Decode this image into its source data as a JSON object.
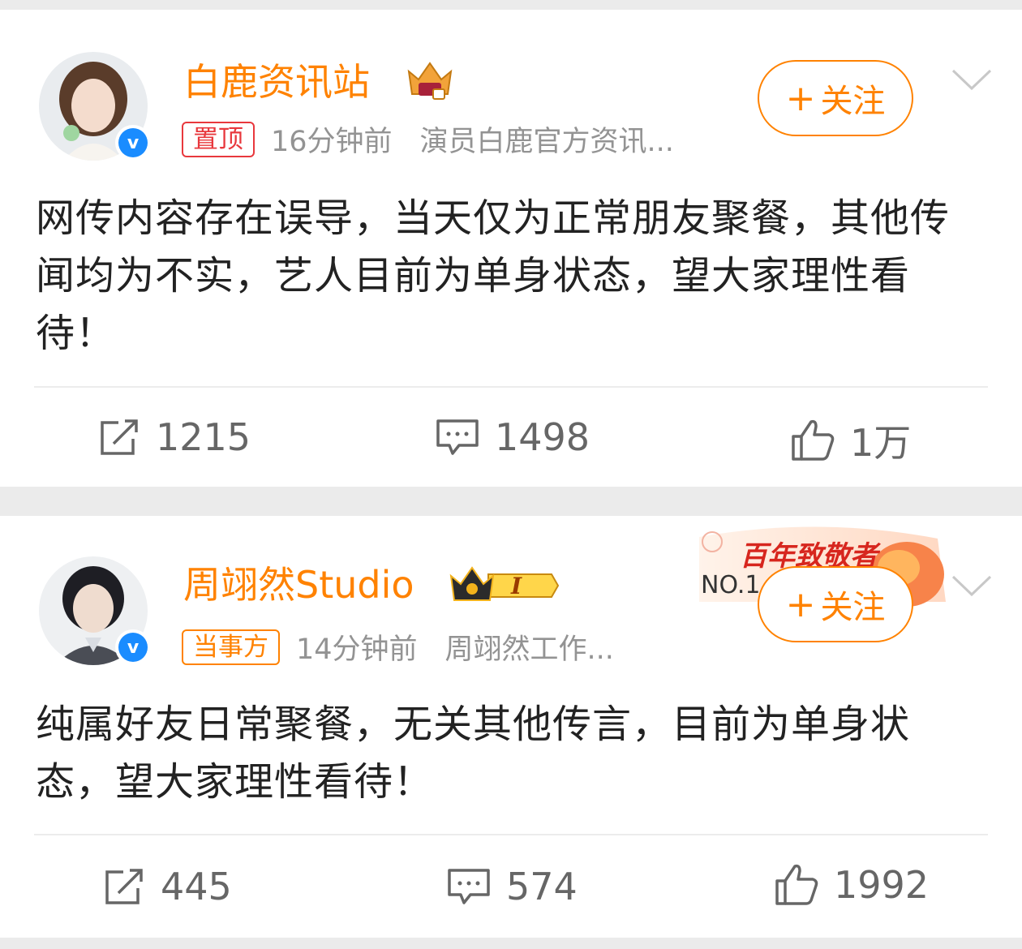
{
  "posts": [
    {
      "author": "白鹿资讯站",
      "tag": "置顶",
      "time": "16分钟前",
      "source": "演员白鹿官方资讯...",
      "verified_label": "v",
      "follow_plus": "+",
      "follow_label": "关注",
      "content": "网传内容存在误导，当天仅为正常朋友聚餐，其他传闻均为不实，艺人目前为单身状态，望大家理性看待！",
      "reposts": "1215",
      "comments": "1498",
      "likes": "1万"
    },
    {
      "author": "周翊然Studio",
      "tag": "当事方",
      "time": "14分钟前",
      "source": "周翊然工作...",
      "verified_label": "v",
      "follow_plus": "+",
      "follow_label": "关注",
      "badge_level": "I",
      "promo_title": "百年致敬者",
      "promo_no": "NO.1",
      "content": "纯属好友日常聚餐，无关其他传言，目前为单身状态，望大家理性看待！",
      "reposts": "445",
      "comments": "574",
      "likes": "1992"
    }
  ],
  "colors": {
    "accent": "#ff8200",
    "verified": "#1a8cff",
    "pinned": "#e8383d"
  },
  "icons": [
    "repost-icon",
    "comment-icon",
    "like-icon",
    "chevron-down-icon",
    "crown-badge-icon",
    "verified-icon"
  ]
}
